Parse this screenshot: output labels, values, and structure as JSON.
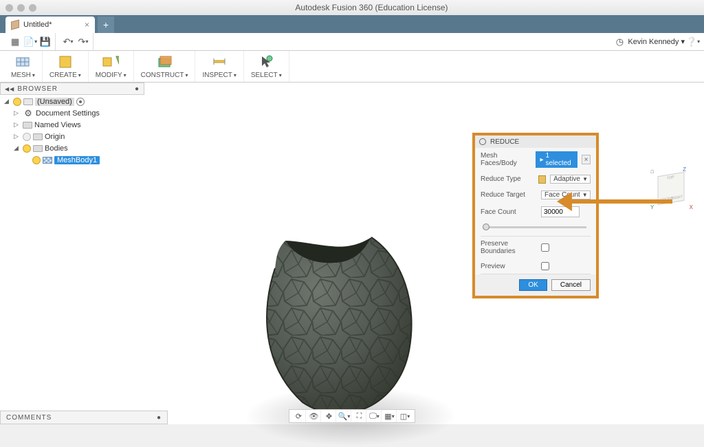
{
  "window": {
    "title": "Autodesk Fusion 360 (Education License)"
  },
  "tab": {
    "title": "Untitled*"
  },
  "user": {
    "name": "Kevin Kennedy"
  },
  "ribbon": {
    "workspace": "MESH",
    "create": "CREATE",
    "modify": "MODIFY",
    "construct": "CONSTRUCT",
    "inspect": "INSPECT",
    "select": "SELECT"
  },
  "browser": {
    "title": "BROWSER",
    "root": "(Unsaved)",
    "doc_settings": "Document Settings",
    "named_views": "Named Views",
    "origin": "Origin",
    "bodies": "Bodies",
    "meshbody": "MeshBody1"
  },
  "viewcube": {
    "top": "TOP",
    "front": "FRONT",
    "right": "RIGHT",
    "z": "Z",
    "y": "Y",
    "x": "X"
  },
  "dialog": {
    "title": "REDUCE",
    "mesh_faces_label": "Mesh Faces/Body",
    "selected_chip": "1 selected",
    "reduce_type_label": "Reduce Type",
    "reduce_type_value": "Adaptive",
    "reduce_target_label": "Reduce Target",
    "reduce_target_value": "Face Count",
    "face_count_label": "Face Count",
    "face_count_value": "30000",
    "preserve_label": "Preserve Boundaries",
    "preview_label": "Preview",
    "ok": "OK",
    "cancel": "Cancel"
  },
  "comments": {
    "title": "COMMENTS"
  }
}
